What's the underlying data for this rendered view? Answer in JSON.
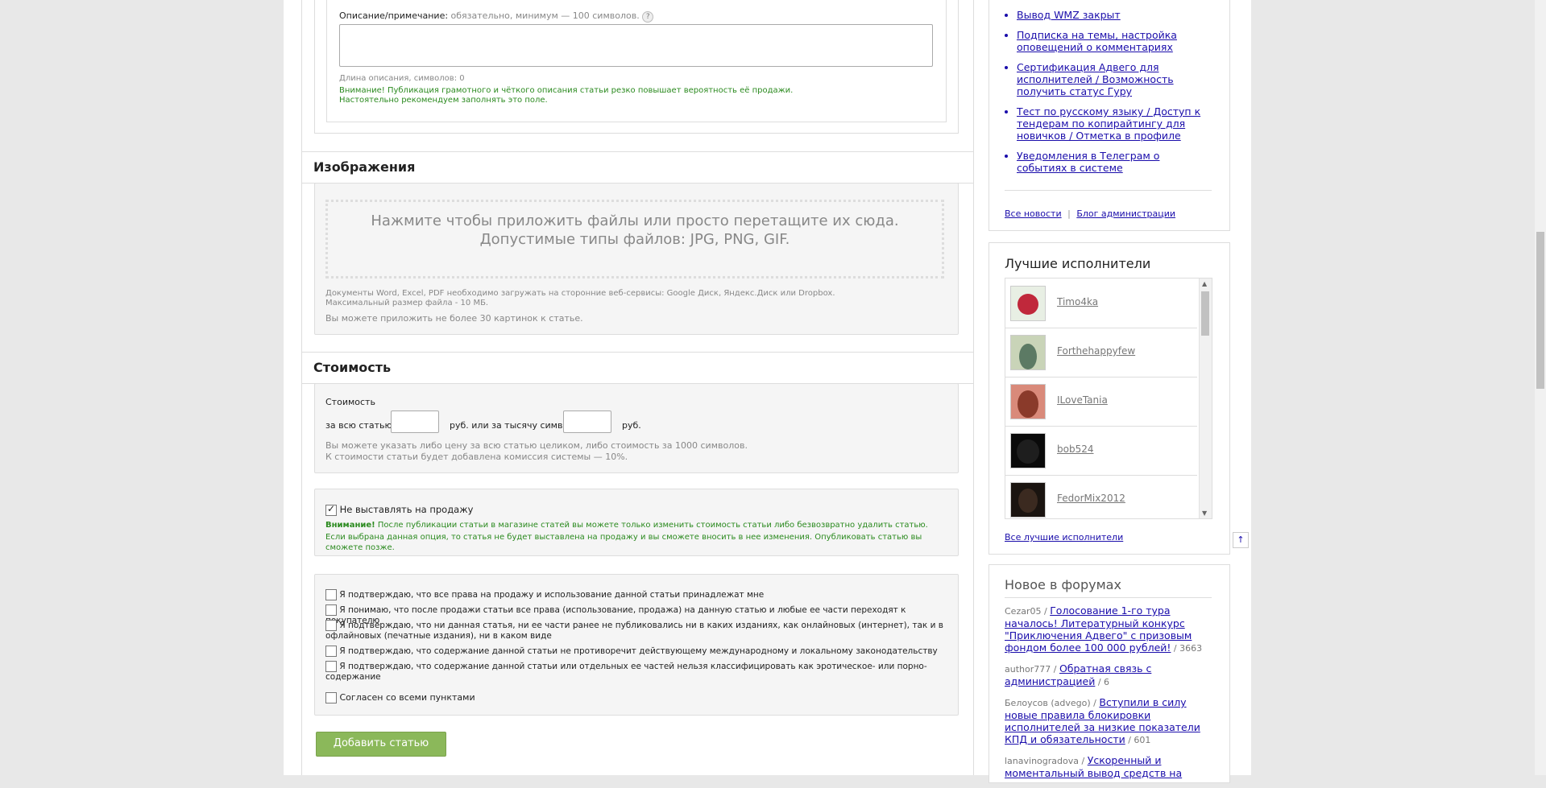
{
  "description": {
    "label": "Описание/примечание:",
    "hint": "обязательно, минимум — 100 символов.",
    "help": "?",
    "length_label": "Длина описания, символов: 0",
    "warning_line1": "Внимание! Публикация грамотного и чёткого описания статьи резко повышает вероятность её продажи.",
    "warning_line2": "Настоятельно рекомендуем заполнять это поле."
  },
  "images": {
    "title": "Изображения",
    "dropzone_line1": "Нажмите чтобы приложить файлы или просто перетащите их сюда.",
    "dropzone_line2": "Допустимые типы файлов: JPG, PNG, GIF.",
    "note_line1": "Документы Word, Excel, PDF необходимо загружать на сторонние веб-сервисы: Google Диск, Яндекс.Диск или Dropbox.",
    "note_line2": "Максимальный размер файла - 10 МБ.",
    "limit": "Вы можете приложить не более 30 картинок к статье."
  },
  "price": {
    "title": "Стоимость",
    "label": "Стоимость",
    "whole_label": "за всю статью",
    "rub_or": "руб. или за тысячу символов",
    "rub": "руб.",
    "whole_value": "",
    "per_thousand_value": "",
    "hint_line1": "Вы можете указать либо цену за всю статью целиком, либо стоимость за 1000 символов.",
    "hint_line2": "К стоимости статьи будет добавлена комиссия системы — 10%."
  },
  "not_for_sale": {
    "checked": true,
    "label": "Не выставлять на продажу",
    "warning_bold": "Внимание!",
    "warning_line1": " После публикации статьи в магазине статей вы можете только изменить стоимость статьи либо безвозвратно удалить статью.",
    "warning_line2": "Если выбрана данная опция, то статья не будет выставлена на продажу и вы сможете вносить в нее изменения. Опубликовать статью вы сможете позже."
  },
  "agreements": [
    "Я подтверждаю, что все права на продажу и использование данной статьи принадлежат мне",
    "Я понимаю, что после продажи статьи все права (использование, продажа) на данную статью и любые ее части переходят к покупателю",
    "Я подтверждаю, что ни данная статья, ни ее части ранее не публиковались ни в каких изданиях, как онлайновых (интернет), так и в офлайновых (печатные издания), ни в каком виде",
    "Я подтверждаю, что содержание данной статьи не противоречит действующему международному и локальному законодательству",
    "Я подтверждаю, что содержание данной статьи или отдельных ее частей нельзя классифицировать как эротическое- или порно- содержание"
  ],
  "agree_all": "Согласен со всеми пунктами",
  "submit_label": "Добавить статью",
  "sidebar": {
    "news": [
      "Вывод WMZ закрыт",
      "Подписка на темы, настройка оповещений о комментариях",
      "Сертификация Адвего для исполнителей / Возможность получить статус Гуру",
      "Тест по русскому языку / Доступ к тендерам по копирайтингу для новичков / Отметка в профиле",
      "Уведомления в Телеграм о событиях в системе"
    ],
    "all_news": "Все новости",
    "separator": "|",
    "admin_blog": "Блог администрации",
    "best_title": "Лучшие исполнители",
    "performers": [
      "Timo4ka",
      "Forthehappyfew",
      "ILoveTania",
      "bob524",
      "FedorMix2012"
    ],
    "performer_colors": [
      "#c0283b",
      "#5c7a64",
      "#8a3a2a",
      "#1e1e1e",
      "#3b2a20"
    ],
    "all_best": "Все лучшие исполнители",
    "forum_title": "Новое в форумах",
    "forum": [
      {
        "author": "Cezar05",
        "sep": " / ",
        "topic": "Голосование 1-го тура началось! Литературный конкурс \"Приключения Адвего\" с призовым фондом более 100 000 рублей!",
        "count": " / 3663"
      },
      {
        "author": "author777",
        "sep": " / ",
        "topic": "Обратная связь с администрацией",
        "count": " / 6"
      },
      {
        "author": "Белоусов (advego)",
        "sep": " / ",
        "topic": "Вступили в силу новые правила блокировки исполнителей за низкие показатели КПД и обязательности",
        "count": " / 601"
      },
      {
        "author": "lanavinogradova",
        "sep": " / ",
        "topic": "Ускоренный и моментальный вывод средств на",
        "count": ""
      }
    ]
  },
  "scroll_top_icon": "↑"
}
